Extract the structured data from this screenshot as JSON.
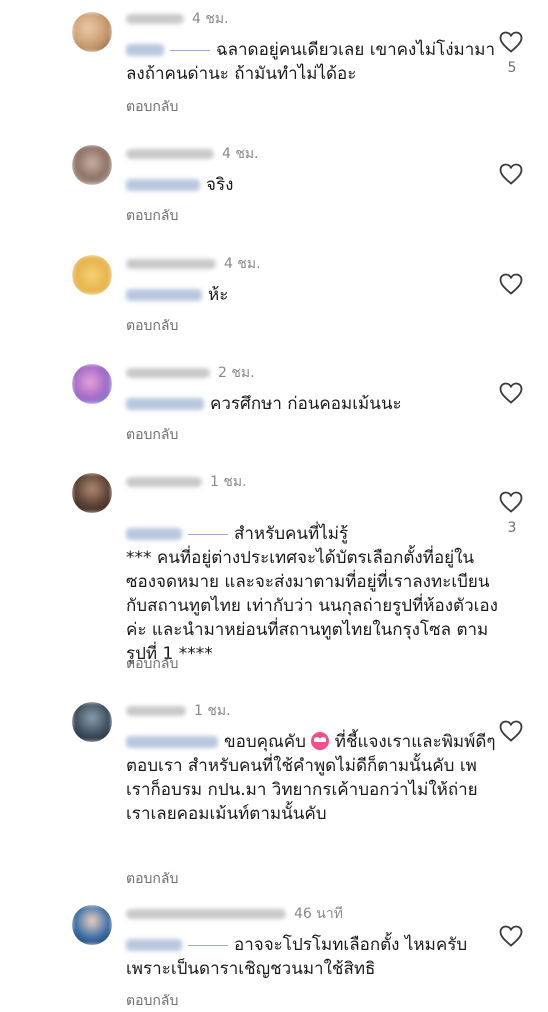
{
  "reply_label": "ตอบกลับ",
  "comments": [
    {
      "time": "4 ชม.",
      "text": "ฉลาดอยู่คนเดียวเลย เขาคงไม่โง่มามาลงถ้าคนด่านะ ถ้ามันทำไม่ได้อะ",
      "likes": "5"
    },
    {
      "time": "4 ชม.",
      "text": "จริง",
      "likes": ""
    },
    {
      "time": "4 ชม.",
      "text": "ห้ะ",
      "likes": ""
    },
    {
      "time": "2 ชม.",
      "text": "ควรศึกษา ก่อนคอมเม้นนะ",
      "likes": ""
    },
    {
      "time": "1 ชม.",
      "text": "สำหรับคนที่ไม่รู้\n*** คนที่อยู่ต่างประเทศจะได้บัตรเลือกตั้งที่อยู่ในซองจดหมาย และจะส่งมาตามที่อยู่ที่เราลงทะเบียนกับสถานทูตไทย เท่ากับว่า นนกุลถ่ายรูปที่ห้องตัวเองค่ะ และนำมาหย่อนที่สถานทูตไทยในกรุงโซล ตามรูปที่ 1 ****",
      "likes": "3"
    },
    {
      "time": "1 ชม.",
      "text_before_emoji": "ขอบคุณคับ",
      "text": "ที่ชี้แจงเราและพิมพ์ดีๆตอบเรา สำหรับคนที่ใช้คำพูดไม่ดีก็ตามนั้นคับ  เพเราก็อบรม กปน.มา วิทยากรเค้าบอกว่าไม่ให้ถ่าย เราเลยคอมเม้นท์ตามนั้นคับ",
      "likes": ""
    },
    {
      "time": "46 นาที",
      "text": "อาจจะโปรโมทเลือกตั้ง ไหมครับ เพราะเป็นดาราเชิญชวนมาใช้สิทธิ",
      "likes": ""
    }
  ],
  "colors": {
    "text": "#1a1a1a",
    "muted": "#8a8a8a",
    "mention": "#b9c7de"
  },
  "icons": {
    "like": "heart-outline-icon"
  }
}
